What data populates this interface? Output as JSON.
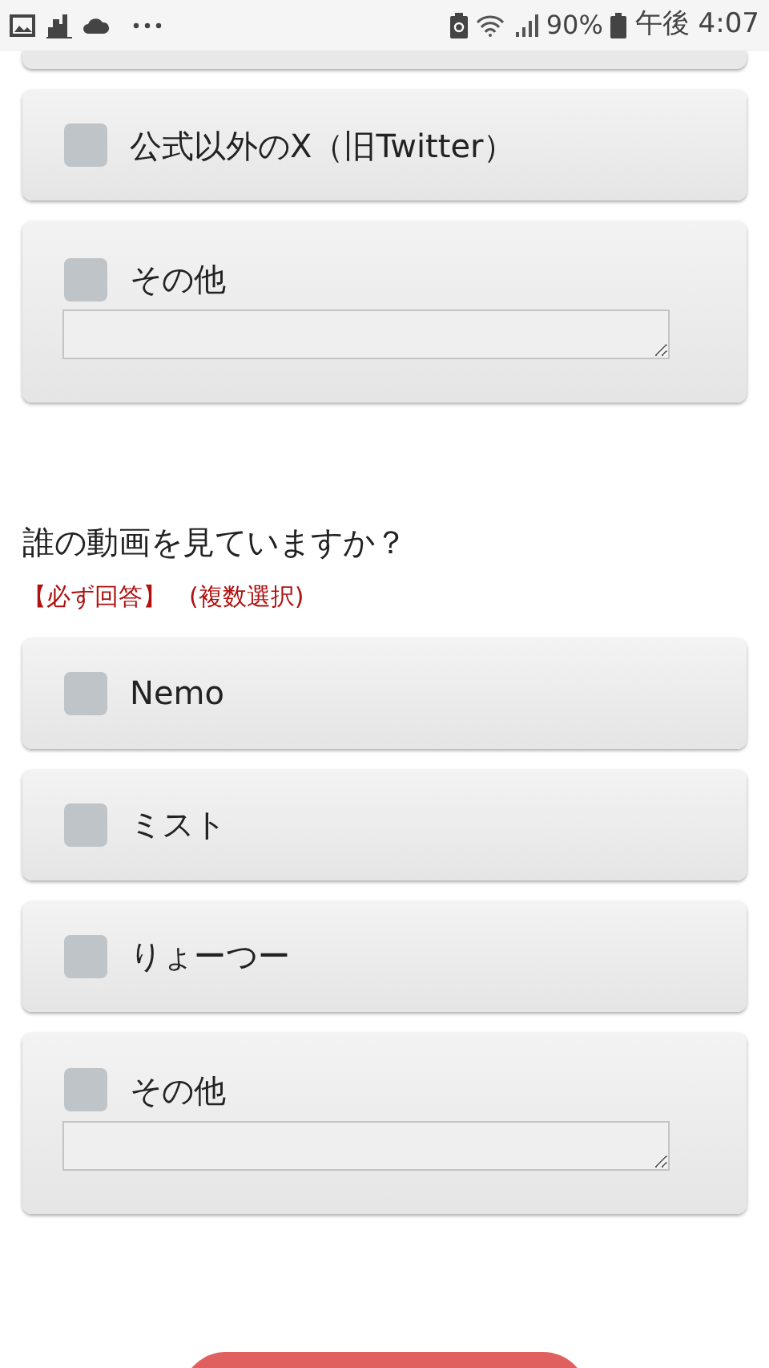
{
  "status_bar": {
    "battery": "90%",
    "time": "午後 4:07"
  },
  "question_1": {
    "options": [
      {
        "kind": "checkbox",
        "label": "公式以外のX（旧Twitter）",
        "checked": false
      },
      {
        "kind": "other",
        "label": "その他",
        "checked": false
      }
    ]
  },
  "question_2": {
    "title": "誰の動画を見ていますか？",
    "required": "【必ず回答】",
    "note": "(複数選択)",
    "options": [
      {
        "kind": "checkbox",
        "label": "Nemo",
        "checked": false
      },
      {
        "kind": "checkbox",
        "label": "ミスト",
        "checked": false
      },
      {
        "kind": "checkbox",
        "label": "りょーつー",
        "checked": false
      },
      {
        "kind": "other",
        "label": "その他",
        "checked": false
      }
    ]
  }
}
